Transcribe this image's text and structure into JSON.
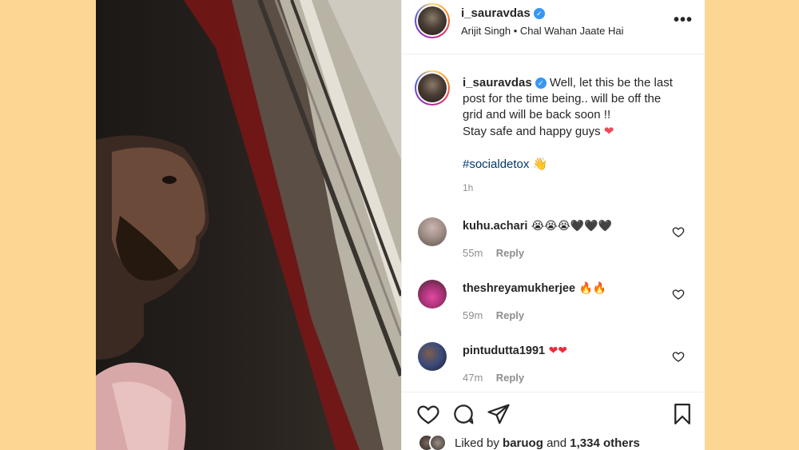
{
  "post": {
    "author": "i_sauravdas",
    "music": "Arijit Singh • Chal Wahan Jaate Hai",
    "more_icon": "more-options-icon"
  },
  "caption": {
    "author": "i_sauravdas",
    "line1": "Well, let this be the last",
    "line2": "post for the time being.. will be off the",
    "line3": "grid and will be back soon !!",
    "line4": "Stay safe and happy guys",
    "line4_emoji": "❤",
    "hashtag": "#socialdetox",
    "hashtag_emoji": "👋",
    "time": "1h"
  },
  "comments": [
    {
      "user": "kuhu.achari",
      "text": "😭😭😭🖤🖤🖤",
      "time": "55m",
      "reply": "Reply"
    },
    {
      "user": "theshreyamukherjee",
      "text": "🔥🔥",
      "time": "59m",
      "reply": "Reply"
    },
    {
      "user": "pintudutta1991",
      "text": "❤❤",
      "time": "47m",
      "reply": "Reply"
    }
  ],
  "likes": {
    "prefix": "Liked by",
    "user": "baruog",
    "conjunction": "and",
    "count": "1,334 others"
  },
  "colors": {
    "background": "#fdd693",
    "verified": "#3897f0",
    "hashtag": "#00376b",
    "heart": "#ed4956"
  }
}
